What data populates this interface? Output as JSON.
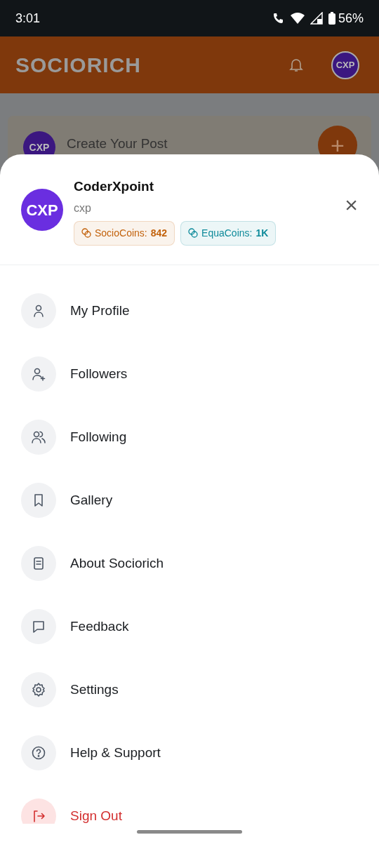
{
  "status_bar": {
    "time": "3:01",
    "battery": "56%"
  },
  "app_bar": {
    "logo": "SOCIORICH",
    "avatar": "CXP"
  },
  "post_card": {
    "avatar": "CXP",
    "title": "Create Your Post",
    "add": "+"
  },
  "sheet": {
    "avatar": "CXP",
    "name": "CoderXpoint",
    "handle": "cxp",
    "close": "×",
    "coins": [
      {
        "label": "SocioCoins:",
        "value": "842",
        "color": "#c2620c"
      },
      {
        "label": "EquaCoins:",
        "value": "1K",
        "color": "#0e8a9a"
      }
    ],
    "items": [
      {
        "label": "My Profile",
        "kind": "normal"
      },
      {
        "label": "Followers",
        "kind": "normal"
      },
      {
        "label": "Following",
        "kind": "normal"
      },
      {
        "label": "Gallery",
        "kind": "normal"
      },
      {
        "label": "About Sociorich",
        "kind": "normal"
      },
      {
        "label": "Feedback",
        "kind": "normal"
      },
      {
        "label": "Settings",
        "kind": "normal"
      },
      {
        "label": "Help & Support",
        "kind": "normal"
      },
      {
        "label": "Sign Out",
        "kind": "danger"
      }
    ]
  }
}
